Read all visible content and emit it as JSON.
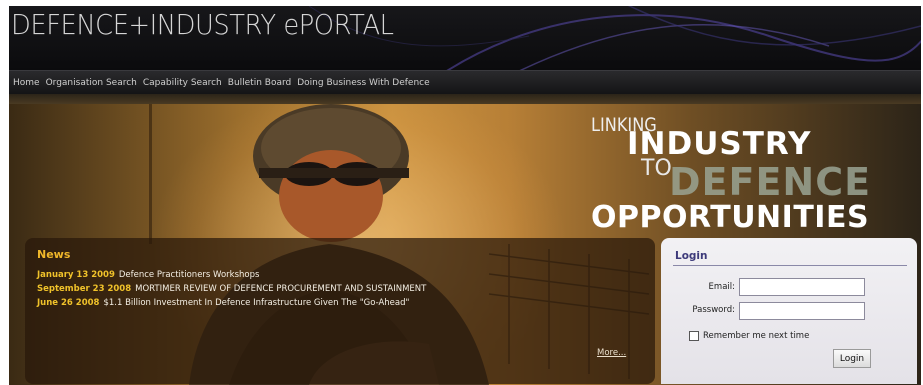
{
  "header": {
    "logo_text": "DEFENCE+INDUSTRY ePORTAL"
  },
  "nav": {
    "items": [
      {
        "label": "Home"
      },
      {
        "label": "Organisation Search"
      },
      {
        "label": "Capability Search"
      },
      {
        "label": "Bulletin Board"
      },
      {
        "label": "Doing Business With Defence"
      }
    ]
  },
  "hero": {
    "tagline": {
      "linking": "LINKING",
      "industry": "INDUSTRY",
      "to": "TO",
      "defence": "DEFENCE",
      "opportunities": "OPPORTUNITIES"
    }
  },
  "news": {
    "title": "News",
    "items": [
      {
        "date": "January 13 2009",
        "text": "Defence Practitioners Workshops"
      },
      {
        "date": "September 23 2008",
        "text": "MORTIMER REVIEW OF DEFENCE PROCUREMENT AND SUSTAINMENT"
      },
      {
        "date": "June 26 2008",
        "text": "$1.1 Billion Investment In Defence Infrastructure Given The \"Go-Ahead\""
      }
    ],
    "more_label": "More..."
  },
  "login": {
    "title": "Login",
    "email_label": "Email:",
    "email_value": "",
    "password_label": "Password:",
    "password_value": "",
    "remember_label": "Remember me next time",
    "remember_checked": false,
    "button_label": "Login"
  },
  "colors": {
    "accent_gold": "#f0b72a",
    "login_title": "#3d3a7a",
    "nav_bg": "#1a1a1c"
  }
}
